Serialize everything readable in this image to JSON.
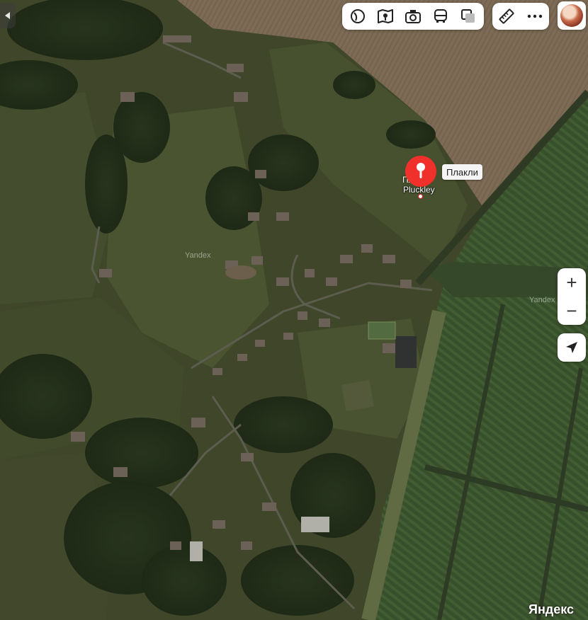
{
  "map": {
    "type": "satellite",
    "watermarks": [
      "Yandex",
      "Yandex"
    ],
    "logo": "Яндекс"
  },
  "marker": {
    "label": "Плакли",
    "place_name_en": "Pluckley",
    "place_name_ru": "Плакли",
    "color": "#f0302a"
  },
  "toolbar": {
    "layers": [
      {
        "name": "satellite-layer-button",
        "icon": "circle-layers-icon"
      },
      {
        "name": "panorama-button",
        "icon": "panorama-map-icon"
      },
      {
        "name": "photos-button",
        "icon": "camera-icon"
      },
      {
        "name": "transport-button",
        "icon": "bus-icon"
      },
      {
        "name": "layers-button",
        "icon": "layers-icon"
      }
    ],
    "tools": [
      {
        "name": "ruler-button",
        "icon": "ruler-icon"
      },
      {
        "name": "more-button",
        "icon": "more-dots-icon"
      }
    ]
  },
  "controls": {
    "zoom_in": "+",
    "zoom_out": "−",
    "locate_icon": "navigation-arrow-icon"
  }
}
